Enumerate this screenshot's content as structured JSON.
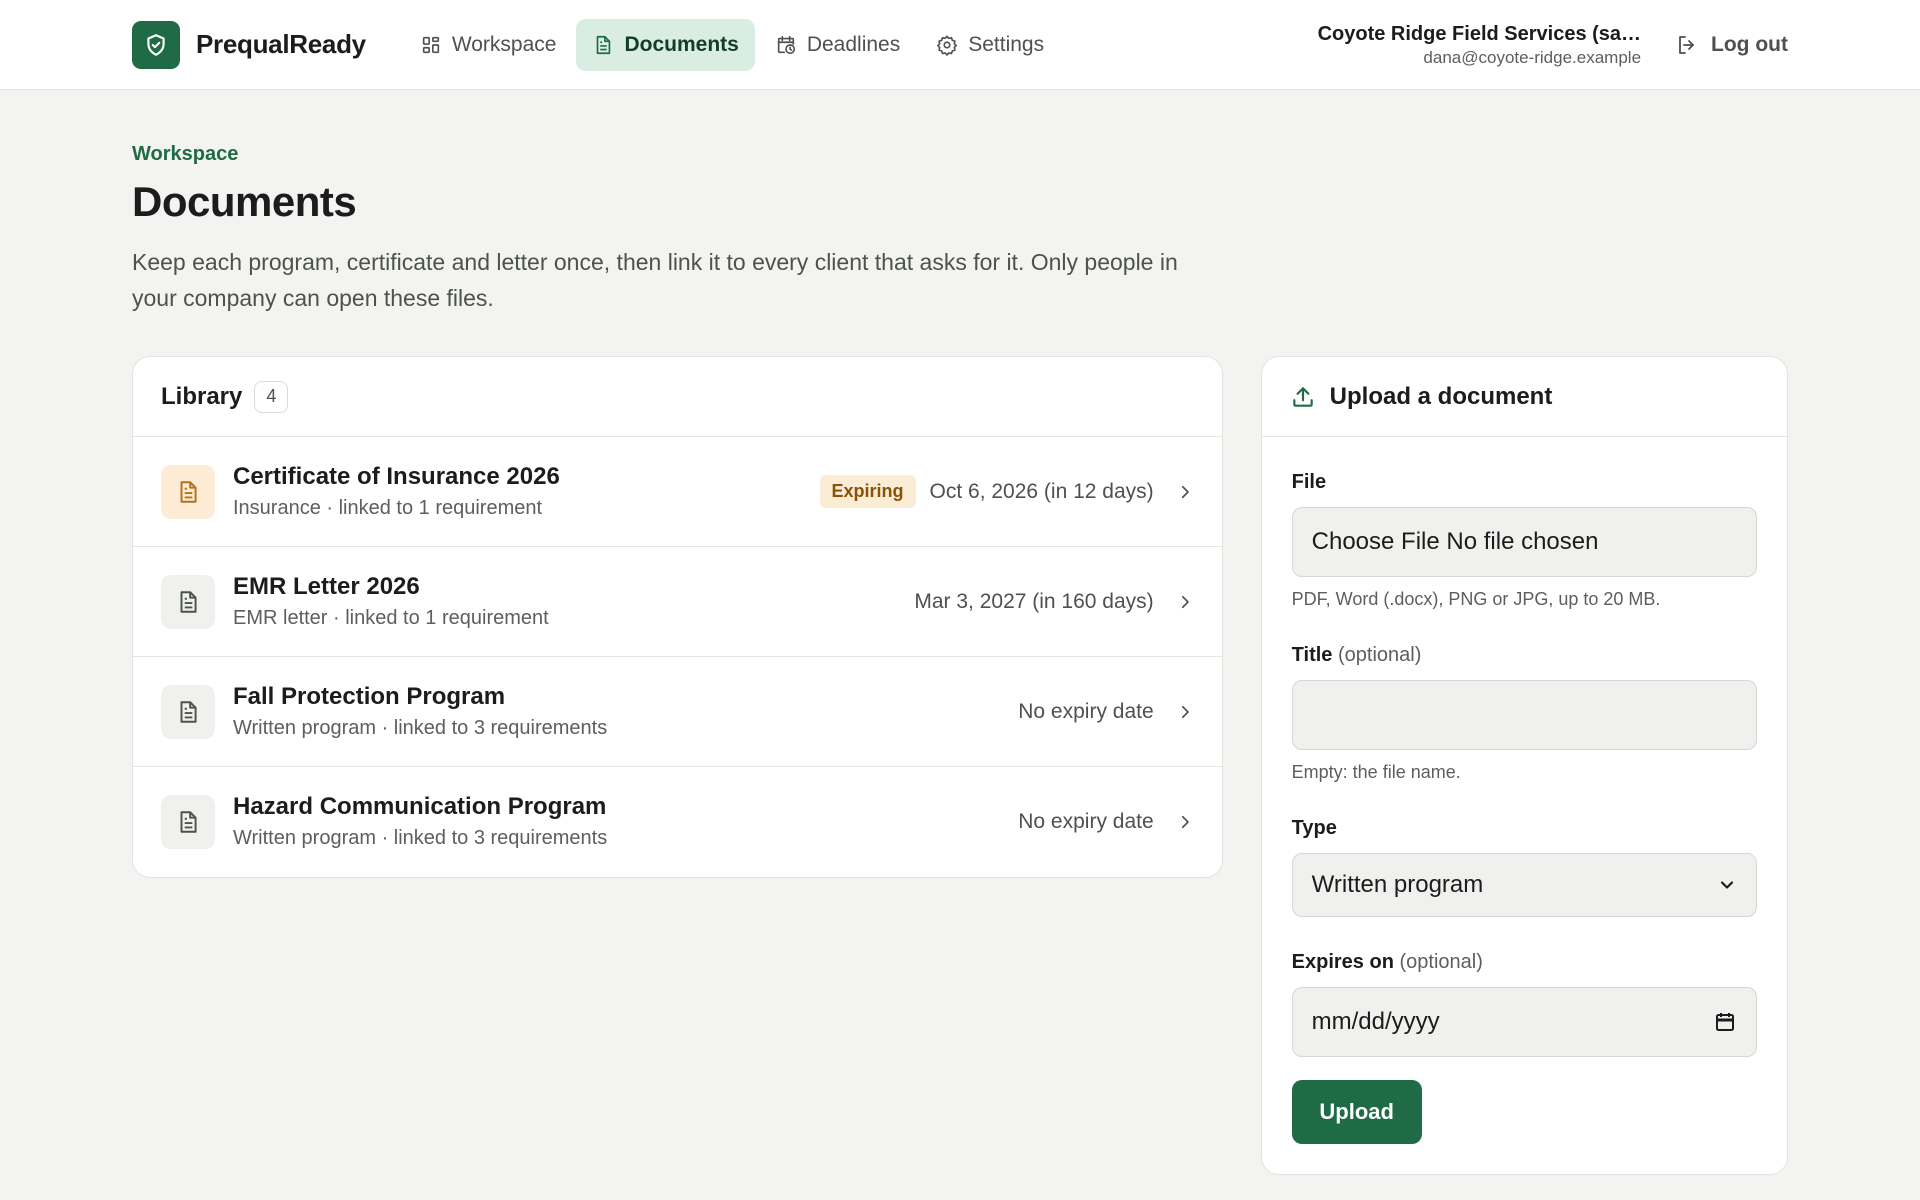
{
  "brand": {
    "name": "PrequalReady"
  },
  "nav": [
    {
      "label": "Workspace",
      "icon": "grid-icon",
      "active": false
    },
    {
      "label": "Documents",
      "icon": "document-icon",
      "active": true
    },
    {
      "label": "Deadlines",
      "icon": "calendar-clock-icon",
      "active": false
    },
    {
      "label": "Settings",
      "icon": "gear-icon",
      "active": false
    }
  ],
  "account": {
    "name": "Coyote Ridge Field Services (sa…",
    "email": "dana@coyote-ridge.example",
    "logout_label": "Log out"
  },
  "header": {
    "eyebrow": "Workspace",
    "title": "Documents",
    "description": "Keep each program, certificate and letter once, then link it to every client that asks for it. Only people in your company can open these files."
  },
  "library": {
    "title": "Library",
    "count": "4",
    "documents": [
      {
        "title": "Certificate of Insurance 2026",
        "meta": "Insurance · linked to 1 requirement",
        "badge": "Expiring",
        "date": "Oct 6, 2026 (in 12 days)",
        "status": "expiring"
      },
      {
        "title": "EMR Letter 2026",
        "meta": "EMR letter · linked to 1 requirement",
        "badge": "",
        "date": "Mar 3, 2027 (in 160 days)",
        "status": "ok"
      },
      {
        "title": "Fall Protection Program",
        "meta": "Written program · linked to 3 requirements",
        "badge": "",
        "date": "No expiry date",
        "status": "none"
      },
      {
        "title": "Hazard Communication Program",
        "meta": "Written program · linked to 3 requirements",
        "badge": "",
        "date": "No expiry date",
        "status": "none"
      }
    ]
  },
  "upload": {
    "title": "Upload a document",
    "file_label": "File",
    "file_value": "Choose File No file chosen",
    "file_hint": "PDF, Word (.docx), PNG or JPG, up to 20 MB.",
    "title_label": "Title",
    "title_optional": "(optional)",
    "title_value": "",
    "title_hint": "Empty: the file name.",
    "type_label": "Type",
    "type_value": "Written program",
    "expires_label": "Expires on",
    "expires_optional": "(optional)",
    "expires_placeholder": "mm/dd/yyyy",
    "submit_label": "Upload"
  },
  "colors": {
    "brand": "#1e6b45",
    "nav_active_bg": "#d9ede2",
    "expiring_bg": "#fbecd5",
    "expiring_text": "#8a5208",
    "page_bg": "#f3f4f1"
  }
}
